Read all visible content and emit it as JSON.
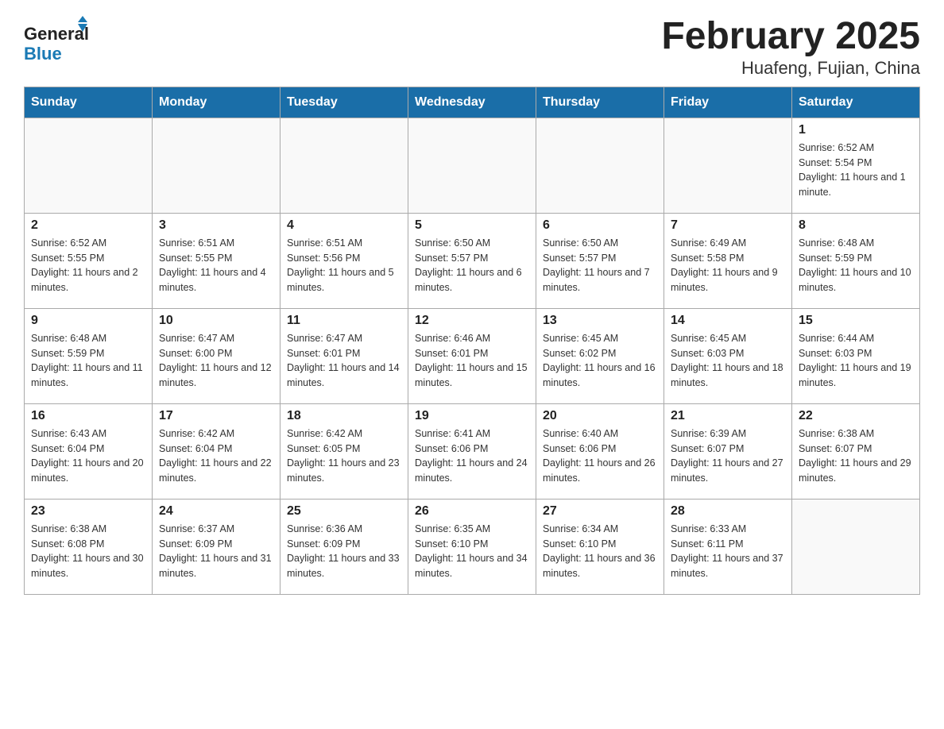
{
  "header": {
    "logo_general": "General",
    "logo_blue": "Blue",
    "title": "February 2025",
    "subtitle": "Huafeng, Fujian, China"
  },
  "days_of_week": [
    "Sunday",
    "Monday",
    "Tuesday",
    "Wednesday",
    "Thursday",
    "Friday",
    "Saturday"
  ],
  "weeks": [
    [
      {
        "day": "",
        "info": ""
      },
      {
        "day": "",
        "info": ""
      },
      {
        "day": "",
        "info": ""
      },
      {
        "day": "",
        "info": ""
      },
      {
        "day": "",
        "info": ""
      },
      {
        "day": "",
        "info": ""
      },
      {
        "day": "1",
        "info": "Sunrise: 6:52 AM\nSunset: 5:54 PM\nDaylight: 11 hours and 1 minute."
      }
    ],
    [
      {
        "day": "2",
        "info": "Sunrise: 6:52 AM\nSunset: 5:55 PM\nDaylight: 11 hours and 2 minutes."
      },
      {
        "day": "3",
        "info": "Sunrise: 6:51 AM\nSunset: 5:55 PM\nDaylight: 11 hours and 4 minutes."
      },
      {
        "day": "4",
        "info": "Sunrise: 6:51 AM\nSunset: 5:56 PM\nDaylight: 11 hours and 5 minutes."
      },
      {
        "day": "5",
        "info": "Sunrise: 6:50 AM\nSunset: 5:57 PM\nDaylight: 11 hours and 6 minutes."
      },
      {
        "day": "6",
        "info": "Sunrise: 6:50 AM\nSunset: 5:57 PM\nDaylight: 11 hours and 7 minutes."
      },
      {
        "day": "7",
        "info": "Sunrise: 6:49 AM\nSunset: 5:58 PM\nDaylight: 11 hours and 9 minutes."
      },
      {
        "day": "8",
        "info": "Sunrise: 6:48 AM\nSunset: 5:59 PM\nDaylight: 11 hours and 10 minutes."
      }
    ],
    [
      {
        "day": "9",
        "info": "Sunrise: 6:48 AM\nSunset: 5:59 PM\nDaylight: 11 hours and 11 minutes."
      },
      {
        "day": "10",
        "info": "Sunrise: 6:47 AM\nSunset: 6:00 PM\nDaylight: 11 hours and 12 minutes."
      },
      {
        "day": "11",
        "info": "Sunrise: 6:47 AM\nSunset: 6:01 PM\nDaylight: 11 hours and 14 minutes."
      },
      {
        "day": "12",
        "info": "Sunrise: 6:46 AM\nSunset: 6:01 PM\nDaylight: 11 hours and 15 minutes."
      },
      {
        "day": "13",
        "info": "Sunrise: 6:45 AM\nSunset: 6:02 PM\nDaylight: 11 hours and 16 minutes."
      },
      {
        "day": "14",
        "info": "Sunrise: 6:45 AM\nSunset: 6:03 PM\nDaylight: 11 hours and 18 minutes."
      },
      {
        "day": "15",
        "info": "Sunrise: 6:44 AM\nSunset: 6:03 PM\nDaylight: 11 hours and 19 minutes."
      }
    ],
    [
      {
        "day": "16",
        "info": "Sunrise: 6:43 AM\nSunset: 6:04 PM\nDaylight: 11 hours and 20 minutes."
      },
      {
        "day": "17",
        "info": "Sunrise: 6:42 AM\nSunset: 6:04 PM\nDaylight: 11 hours and 22 minutes."
      },
      {
        "day": "18",
        "info": "Sunrise: 6:42 AM\nSunset: 6:05 PM\nDaylight: 11 hours and 23 minutes."
      },
      {
        "day": "19",
        "info": "Sunrise: 6:41 AM\nSunset: 6:06 PM\nDaylight: 11 hours and 24 minutes."
      },
      {
        "day": "20",
        "info": "Sunrise: 6:40 AM\nSunset: 6:06 PM\nDaylight: 11 hours and 26 minutes."
      },
      {
        "day": "21",
        "info": "Sunrise: 6:39 AM\nSunset: 6:07 PM\nDaylight: 11 hours and 27 minutes."
      },
      {
        "day": "22",
        "info": "Sunrise: 6:38 AM\nSunset: 6:07 PM\nDaylight: 11 hours and 29 minutes."
      }
    ],
    [
      {
        "day": "23",
        "info": "Sunrise: 6:38 AM\nSunset: 6:08 PM\nDaylight: 11 hours and 30 minutes."
      },
      {
        "day": "24",
        "info": "Sunrise: 6:37 AM\nSunset: 6:09 PM\nDaylight: 11 hours and 31 minutes."
      },
      {
        "day": "25",
        "info": "Sunrise: 6:36 AM\nSunset: 6:09 PM\nDaylight: 11 hours and 33 minutes."
      },
      {
        "day": "26",
        "info": "Sunrise: 6:35 AM\nSunset: 6:10 PM\nDaylight: 11 hours and 34 minutes."
      },
      {
        "day": "27",
        "info": "Sunrise: 6:34 AM\nSunset: 6:10 PM\nDaylight: 11 hours and 36 minutes."
      },
      {
        "day": "28",
        "info": "Sunrise: 6:33 AM\nSunset: 6:11 PM\nDaylight: 11 hours and 37 minutes."
      },
      {
        "day": "",
        "info": ""
      }
    ]
  ]
}
